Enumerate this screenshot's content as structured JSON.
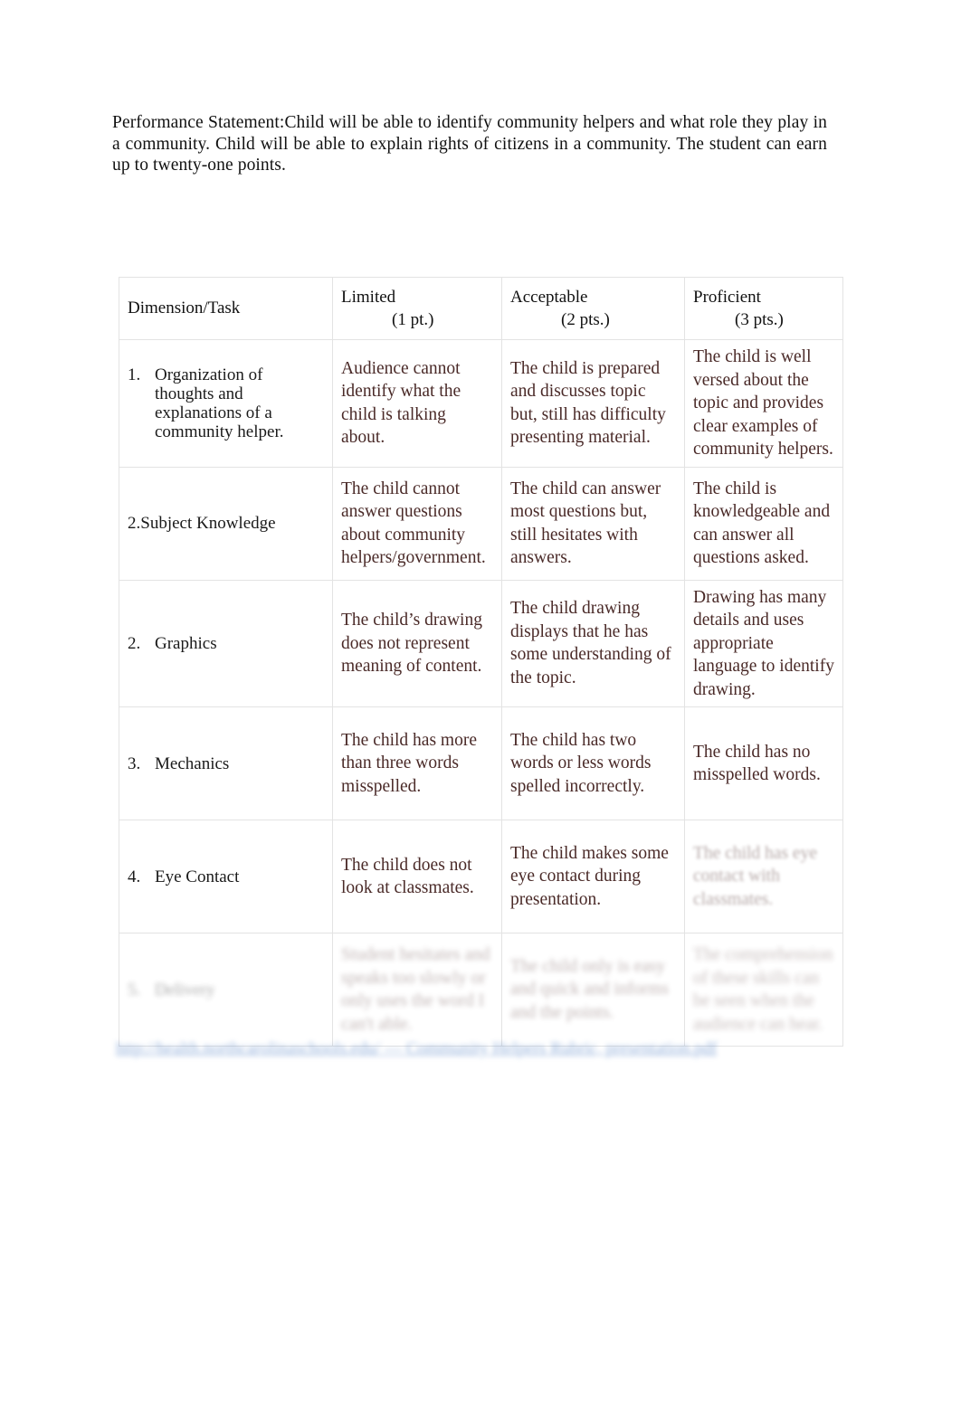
{
  "document": {
    "performance_statement": {
      "label": "Performance Statement:",
      "body": "Child will be able to identify community helpers and what role they play in a community.  Child will be able to explain rights of citizens in a community.  The student can earn up to twenty-one points."
    },
    "rubric": {
      "columns": [
        {
          "name": "Dimension/Task",
          "points": ""
        },
        {
          "name": "Limited",
          "points": "(1 pt.)"
        },
        {
          "name": "Acceptable",
          "points": "(2 pts.)"
        },
        {
          "name": "Proficient",
          "points": "(3 pts.)"
        }
      ],
      "rows": [
        {
          "number": "1.",
          "dimension": "Organization of thoughts and explanations of a community helper.",
          "numbered": true,
          "limited": "Audience cannot identify what the child is talking about.",
          "acceptable": "The child is prepared and discusses topic but, still has difficulty presenting material.",
          "proficient": "The child is well versed about the topic and provides clear examples of community helpers.",
          "legibility": {
            "dimension": "clear",
            "limited": "clear",
            "acceptable": "clear",
            "proficient": "clear"
          }
        },
        {
          "number": "",
          "dimension": "2.Subject Knowledge",
          "numbered": false,
          "limited": "The child cannot answer questions about community helpers/government.",
          "acceptable": "The child can answer most questions but, still hesitates with answers.",
          "proficient": "The child is knowledgeable and can answer all questions asked.",
          "legibility": {
            "dimension": "clear",
            "limited": "clear",
            "acceptable": "clear",
            "proficient": "clear"
          }
        },
        {
          "number": "2.",
          "dimension": "Graphics",
          "numbered": true,
          "limited": "The child’s drawing does not represent meaning of content.",
          "acceptable": "The child drawing displays that he has some understanding of the topic.",
          "proficient": "Drawing has many details and uses appropriate language to identify drawing.",
          "legibility": {
            "dimension": "clear",
            "limited": "clear",
            "acceptable": "clear",
            "proficient": "clear"
          }
        },
        {
          "number": "3.",
          "dimension": "Mechanics",
          "numbered": true,
          "limited": "The child has more than three words misspelled.",
          "acceptable": "The child has two words or less words spelled incorrectly.",
          "proficient": "The child has no misspelled words.",
          "legibility": {
            "dimension": "clear",
            "limited": "clear",
            "acceptable": "clear",
            "proficient": "clear"
          }
        },
        {
          "number": "4.",
          "dimension": "Eye Contact",
          "numbered": true,
          "limited": "The child does not look at classmates.",
          "acceptable": "The child makes some eye contact during presentation.",
          "proficient": "The child has eye contact with classmates.",
          "legibility": {
            "dimension": "clear",
            "limited": "clear",
            "acceptable": "clear",
            "proficient": "faded"
          }
        },
        {
          "number": "5.",
          "dimension": "Delivery",
          "numbered": true,
          "limited": "Student hesitates and speaks too slowly or only uses the word I can't able.",
          "acceptable": "The child only is easy and quick and informs and the points.",
          "proficient": "The comprehension of these skills can be seen when the audience can hear.",
          "legibility": {
            "dimension": "faded",
            "limited": "faded",
            "acceptable": "faded",
            "proficient": "faded"
          }
        }
      ]
    },
    "footer": {
      "link_text": "http://health.northcarolinaschools.edu/ — Community Helpers Rubric, presentation.pdf",
      "color": "#3b6fbd",
      "legibility": "faded"
    }
  }
}
